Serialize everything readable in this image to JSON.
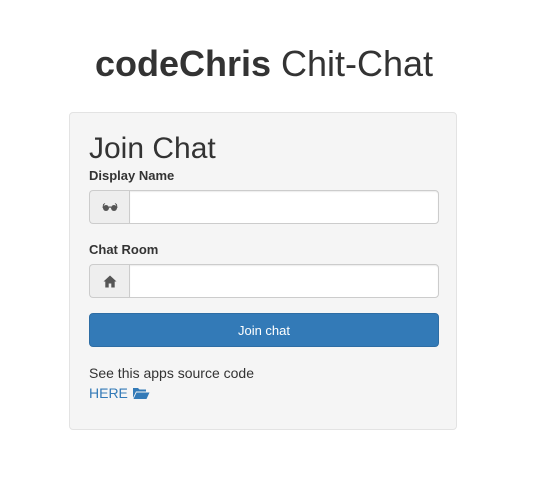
{
  "header": {
    "title_brand": "codeChris",
    "title_rest": " Chit-Chat"
  },
  "panel": {
    "title": "Join Chat",
    "display_name": {
      "label": "Display Name",
      "value": "",
      "icon": "glasses-icon"
    },
    "chat_room": {
      "label": "Chat Room",
      "value": "",
      "icon": "home-icon"
    },
    "join_button_label": "Join chat",
    "source_text": "See this apps source code",
    "source_link": {
      "label": "HERE",
      "icon": "folder-open-icon"
    }
  },
  "colors": {
    "primary": "#337ab7",
    "panel_bg": "#f5f5f5",
    "text": "#333333"
  }
}
